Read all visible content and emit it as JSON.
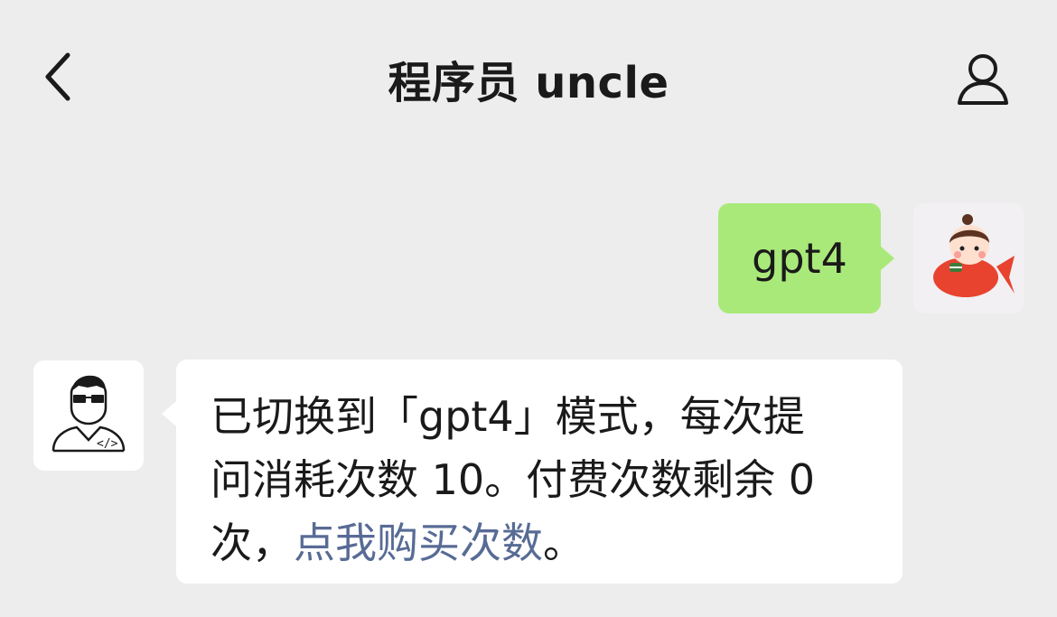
{
  "header": {
    "title": "程序员 uncle",
    "back_icon": "chevron-left-icon",
    "profile_icon": "person-icon"
  },
  "messages": [
    {
      "direction": "outgoing",
      "text": "gpt4",
      "avatar": "girl-cartoon-avatar",
      "bubble_color": "#a9e97a"
    },
    {
      "direction": "incoming",
      "avatar": "programmer-avatar",
      "text_lines": [
        "已切换到「gpt4」模式，每次提",
        "问消耗次数 10。付费次数剩余 0"
      ],
      "line3_prefix": "次，",
      "link_text": "点我购买次数",
      "line3_suffix": "。",
      "link_color": "#576b95",
      "bubble_color": "#ffffff"
    }
  ],
  "colors": {
    "background": "#ededed",
    "text": "#1a1a1a"
  }
}
